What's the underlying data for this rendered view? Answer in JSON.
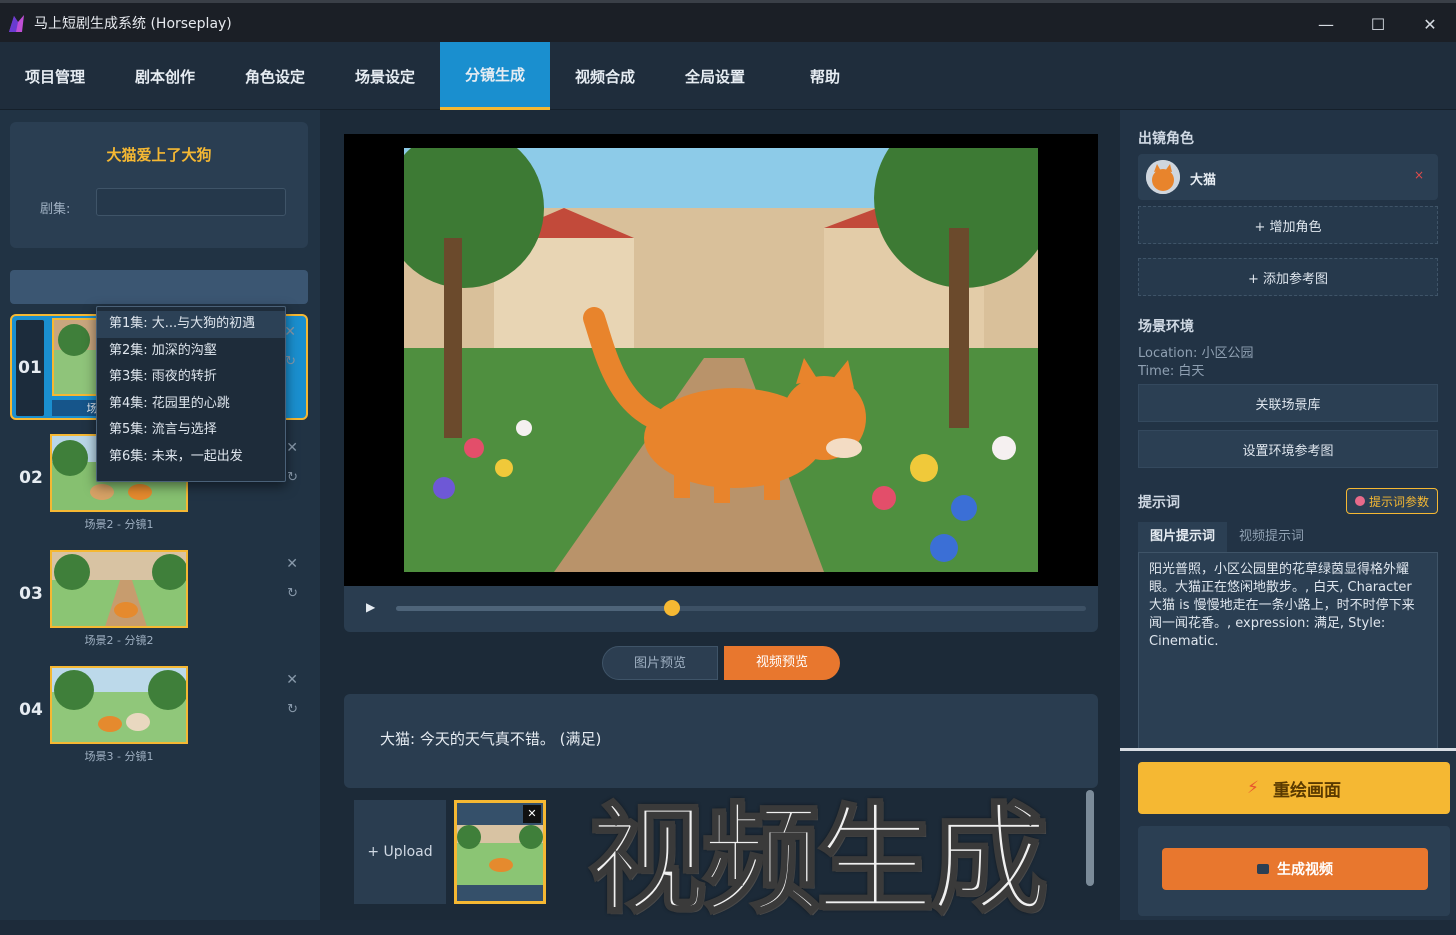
{
  "window": {
    "title": "马上短剧生成系统 (Horseplay)",
    "minimize": "—",
    "maximize": "☐",
    "close": "✕"
  },
  "menu": [
    "项目管理",
    "剧本创作",
    "角色设定",
    "场景设定",
    "分镜生成",
    "视频合成",
    "全局设置",
    "帮助"
  ],
  "menu_active": "分镜生成",
  "project": {
    "title": "大猫爱上了大狗",
    "episode_label": "剧集:",
    "episodes": [
      "第1集: 大...与大狗的初遇",
      "第2集: 加深的沟壑",
      "第3集: 雨夜的转折",
      "第4集: 花园里的心跳",
      "第5集: 流言与选择",
      "第6集: 未来，一起出发"
    ]
  },
  "shots": [
    {
      "num": "01",
      "label": "场景1 - 分镜1"
    },
    {
      "num": "02",
      "label": "场景2 - 分镜1"
    },
    {
      "num": "03",
      "label": "场景2 - 分镜2"
    },
    {
      "num": "04",
      "label": "场景3 - 分镜1"
    }
  ],
  "shot_icons": {
    "delete": "✕",
    "refresh": "↻"
  },
  "player": {
    "play": "▶",
    "progress": 0.4
  },
  "preview_tabs": {
    "image": "图片预览",
    "video": "视频预览"
  },
  "subtitle": "大猫: 今天的天气真不错。 (满足)",
  "upload_label": "+ Upload",
  "ref_close": "✕",
  "watermark": "视频生成",
  "right": {
    "characters_title": "出镜角色",
    "character_name": "大猫",
    "character_remove": "×",
    "add_character": "+ 增加角色",
    "add_reference": "+ 添加参考图",
    "scene_title": "场景环境",
    "location": "Location: 小区公园",
    "time": "Time: 白天",
    "link_scene": "关联场景库",
    "set_env_ref": "设置环境参考图",
    "prompt_title": "提示词",
    "prompt_params": "提示词参数",
    "prompt_tabs": [
      "图片提示词",
      "视频提示词"
    ],
    "prompt_text": "阳光普照，小区公园里的花草绿茵显得格外耀眼。大猫正在悠闲地散步。, 白天, Character 大猫 is 慢慢地走在一条小路上，时不时停下来闻一闻花香。, expression: 满足, Style: Cinematic.",
    "redraw": "重绘画面",
    "generate_video": "生成视频"
  },
  "colors": {
    "accent_blue": "#1a8fcf",
    "accent_yellow": "#f5b833",
    "accent_orange": "#e8772e"
  }
}
